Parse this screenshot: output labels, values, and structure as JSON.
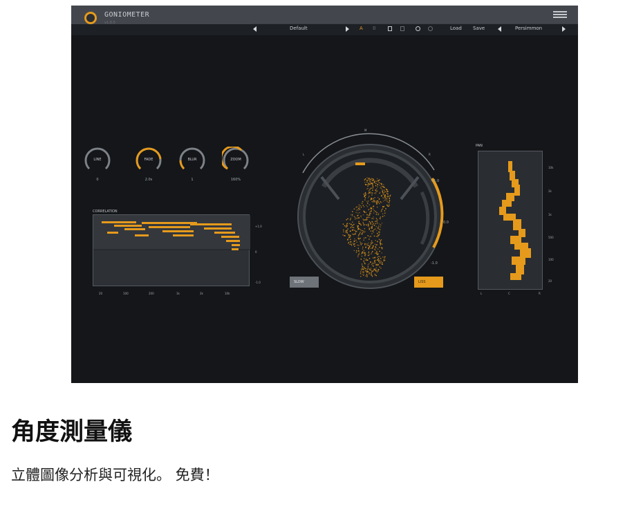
{
  "plugin": {
    "title": "GONIOMETER",
    "version": "v1.0.0",
    "toolbar": {
      "preset": "Default",
      "ab_a": "A",
      "ab_b": "B",
      "load": "Load",
      "save": "Save",
      "theme": "Persimmon"
    },
    "knobs": [
      {
        "label": "LINE",
        "value": "0",
        "level": 0.5
      },
      {
        "label": "FADE",
        "value": "2.0s",
        "level": 0.75
      },
      {
        "label": "BLUR",
        "value": "1",
        "level": 0.3
      },
      {
        "label": "ZOOM",
        "value": "160%",
        "level": 0.6
      }
    ],
    "correlation": {
      "title": "CORRELATION",
      "y_ticks": [
        "+1.0",
        "0",
        "-1.0"
      ],
      "x_ticks": [
        "20",
        "100",
        "200",
        "1k",
        "2k",
        "10k"
      ]
    },
    "scope": {
      "top_label": "M",
      "left_label": "L",
      "right_label": "R",
      "meter_ticks": [
        "+1.0",
        "0.0",
        "-1.0"
      ],
      "slow_button": "SLOW",
      "lissajous_button": "LISS"
    },
    "pan": {
      "title": "PAN",
      "y_ticks": [
        "10k",
        "2k",
        "1k",
        "500",
        "100",
        "20"
      ],
      "x_ticks": [
        "L",
        "C",
        "R"
      ]
    },
    "colors": {
      "accent": "#e59a1c",
      "background": "#141619"
    }
  },
  "page": {
    "heading": "角度測量儀",
    "subtitle": "立體圖像分析與可視化。 免費！"
  }
}
